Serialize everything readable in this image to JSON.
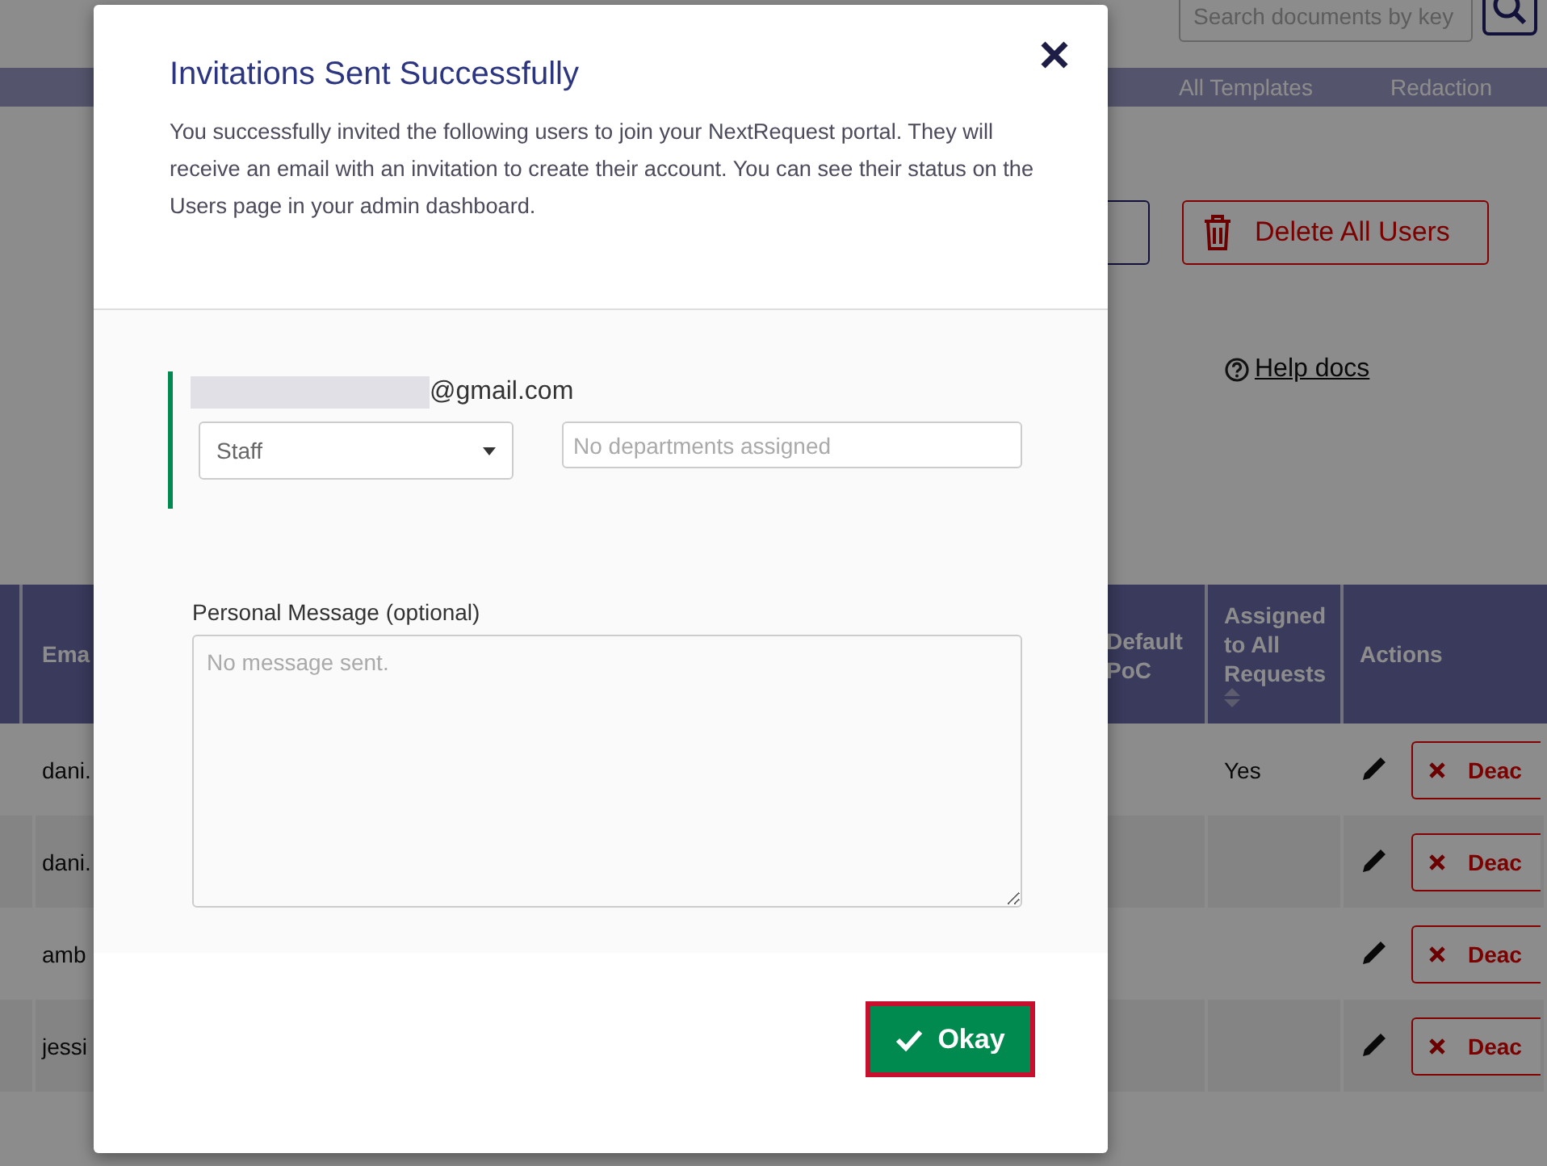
{
  "header": {
    "search": {
      "placeholder": "Search documents by key"
    }
  },
  "nav": {
    "items": [
      "All Templates",
      "Redaction"
    ]
  },
  "toolbar": {
    "delete_button": "Delete All Users",
    "help_link": "Help docs"
  },
  "table": {
    "columns": [
      {
        "label": "Ema",
        "sortable": false
      },
      {
        "label": "Default PoC",
        "sortable": false
      },
      {
        "label": "Assigned to All Requests",
        "sortable": true
      },
      {
        "label": "Actions",
        "sortable": false
      }
    ],
    "rows": [
      {
        "email": "dani.",
        "assigned": "Yes",
        "action": "Deac"
      },
      {
        "email": "dani.",
        "action": "Deac"
      },
      {
        "email": "amb",
        "action": "Deac"
      },
      {
        "email": "jessi",
        "action": "Deac"
      }
    ]
  },
  "modal": {
    "title": "Invitations Sent Successfully",
    "message": "You successfully invited the following users to join your NextRequest portal. They will receive an email with an invitation to create their account. You can see their status on the Users page in your admin dashboard.",
    "invitees": [
      {
        "email": "@gmail.com",
        "role": "Staff",
        "departments_placeholder": "No departments assigned"
      }
    ],
    "message_label": "Personal Message (optional)",
    "message_placeholder": "No message sent.",
    "ok_button": "Okay"
  }
}
